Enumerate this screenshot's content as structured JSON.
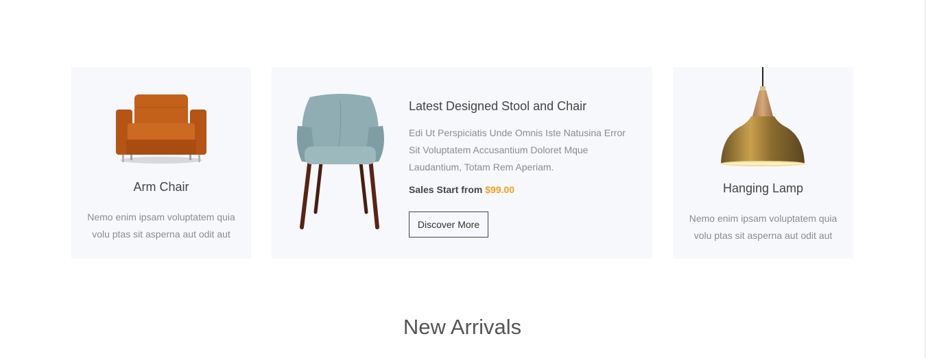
{
  "cards": {
    "left": {
      "title": "Arm Chair",
      "description": "Nemo enim ipsam voluptatem quia volu ptas sit asperna aut odit aut",
      "image_icon": "armchair-image"
    },
    "promo": {
      "title": "Latest Designed Stool and Chair",
      "description": "Edi Ut Perspiciatis Unde Omnis Iste Natusina Error Sit Voluptatem Accusantium Doloret Mque Laudantium, Totam Rem Aperiam.",
      "price_label": "Sales Start from",
      "price_value": "$99.00",
      "button_label": "Discover More",
      "image_icon": "accent-chair-image"
    },
    "right": {
      "title": "Hanging Lamp",
      "description": "Nemo enim ipsam voluptatem quia volu ptas sit asperna aut odit aut",
      "image_icon": "pendant-lamp-image"
    }
  },
  "section": {
    "heading": "New Arrivals"
  },
  "colors": {
    "card_background": "#f7f8fb",
    "price_accent": "#f0a01e",
    "text_dark": "#444444",
    "text_muted": "#8c8c8c"
  }
}
